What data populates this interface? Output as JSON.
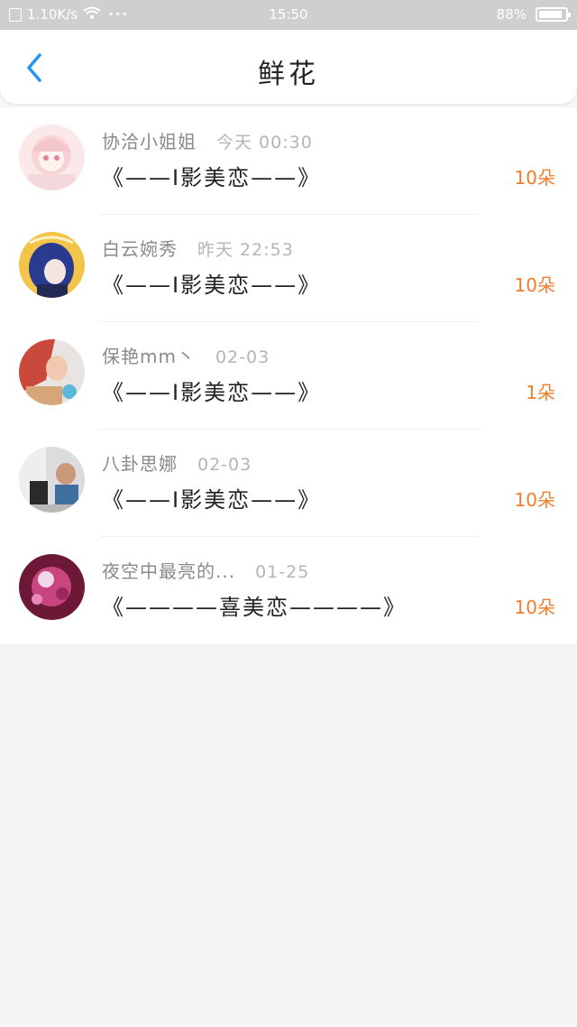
{
  "status_bar": {
    "speed": "1.10K/s",
    "time": "15:50",
    "battery": "88%",
    "battery_level": 0.88
  },
  "header": {
    "title": "鲜花",
    "back_icon": "chevron-left-icon"
  },
  "colors": {
    "accent": "#2196f3",
    "count": "#ef7d2c"
  },
  "records": [
    {
      "name": "协洽小姐姐",
      "date": "今天 00:30",
      "message": "《——I影美恋——》",
      "count": "10朵"
    },
    {
      "name": "白云婉秀",
      "date": "昨天 22:53",
      "message": "《——I影美恋——》",
      "count": "10朵"
    },
    {
      "name": "保艳mm丶",
      "date": "02-03",
      "message": "《——I影美恋——》",
      "count": "1朵"
    },
    {
      "name": "八卦思娜",
      "date": "02-03",
      "message": "《——I影美恋——》",
      "count": "10朵"
    },
    {
      "name": "夜空中最亮的...",
      "date": "01-25",
      "message": "《————喜美恋————》",
      "count": "10朵"
    }
  ]
}
